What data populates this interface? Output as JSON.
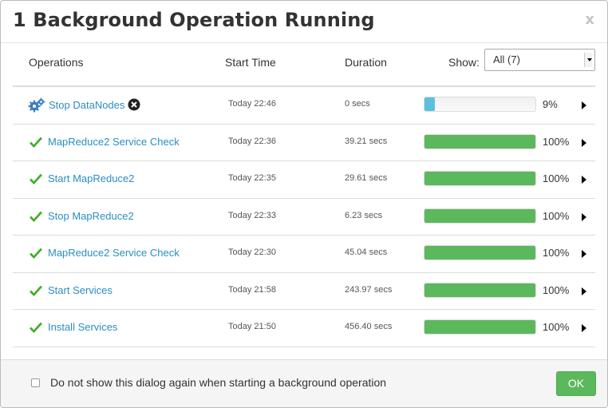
{
  "dialog": {
    "title": "1 Background Operation Running",
    "close_label": "x"
  },
  "table": {
    "headers": {
      "operations": "Operations",
      "start_time": "Start Time",
      "duration": "Duration",
      "show": "Show:"
    },
    "filter": {
      "selected": "All (7)"
    },
    "rows": [
      {
        "name": "Stop DataNodes",
        "status": "running",
        "icon": "gears-icon",
        "start": "Today 22:46",
        "duration": "0 secs",
        "progress": 9,
        "percent": "9%"
      },
      {
        "name": "MapReduce2 Service Check",
        "status": "success",
        "icon": "checkmark-icon",
        "start": "Today 22:36",
        "duration": "39.21 secs",
        "progress": 100,
        "percent": "100%"
      },
      {
        "name": "Start MapReduce2",
        "status": "success",
        "icon": "checkmark-icon",
        "start": "Today 22:35",
        "duration": "29.61 secs",
        "progress": 100,
        "percent": "100%"
      },
      {
        "name": "Stop MapReduce2",
        "status": "success",
        "icon": "checkmark-icon",
        "start": "Today 22:33",
        "duration": "6.23 secs",
        "progress": 100,
        "percent": "100%"
      },
      {
        "name": "MapReduce2 Service Check",
        "status": "success",
        "icon": "checkmark-icon",
        "start": "Today 22:30",
        "duration": "45.04 secs",
        "progress": 100,
        "percent": "100%"
      },
      {
        "name": "Start Services",
        "status": "success",
        "icon": "checkmark-icon",
        "start": "Today 21:58",
        "duration": "243.97 secs",
        "progress": 100,
        "percent": "100%"
      },
      {
        "name": "Install Services",
        "status": "success",
        "icon": "checkmark-icon",
        "start": "Today 21:50",
        "duration": "456.40 secs",
        "progress": 100,
        "percent": "100%"
      }
    ]
  },
  "footer": {
    "checkbox_label": "Do not show this dialog again when starting a background operation",
    "ok_label": "OK"
  },
  "colors": {
    "link": "#2a8ec2",
    "success": "#5cb85c",
    "running": "#5bc0de"
  }
}
